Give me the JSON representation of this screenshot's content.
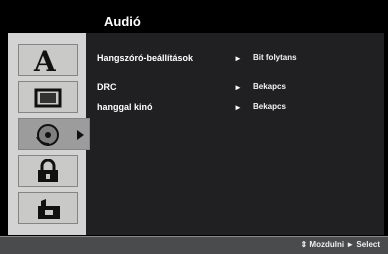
{
  "header": {
    "title": "Audió"
  },
  "sidebar": {
    "items": [
      {
        "icon": "language-icon",
        "active": false
      },
      {
        "icon": "display-icon",
        "active": false
      },
      {
        "icon": "audio-disc-icon",
        "active": true
      },
      {
        "icon": "lock-icon",
        "active": false
      },
      {
        "icon": "settings-icon",
        "active": false
      }
    ]
  },
  "menu": {
    "rows": [
      {
        "label": "Hangszóró-beállítások",
        "arrow": "►",
        "value": "Bit folytans"
      },
      {
        "label": "DRC",
        "arrow": "►",
        "value": "Bekapcs"
      },
      {
        "label": "hanggal kinó",
        "arrow": "►",
        "value": "Bekapcs"
      }
    ]
  },
  "status": {
    "text": "⇕ Mozdulni ► Select"
  }
}
